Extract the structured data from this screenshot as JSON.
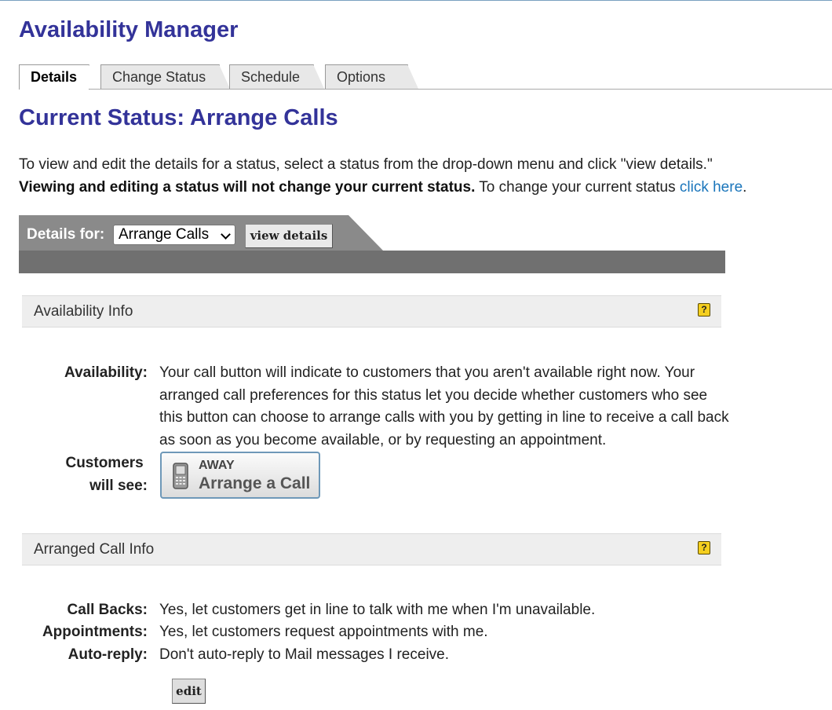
{
  "app_title": "Availability Manager",
  "tabs": [
    {
      "label": "Details",
      "active": true
    },
    {
      "label": "Change Status",
      "active": false
    },
    {
      "label": "Schedule",
      "active": false
    },
    {
      "label": "Options",
      "active": false
    }
  ],
  "status_title": "Current Status: Arrange Calls",
  "intro": {
    "line1": "To view and edit the details for a status, select a status from the drop-down menu and click \"view details.\"",
    "bold": "Viewing and editing a status will not change your current status.",
    "line2_rest": " To change your current status ",
    "link": "click here",
    "period": "."
  },
  "details_bar": {
    "label": "Details for:",
    "selected_status": "Arrange Calls",
    "view_button": "view details"
  },
  "availability_section": {
    "title": "Availability Info",
    "help": "?",
    "availability_key": "Availability:",
    "availability_value": "Your call button will indicate to customers that you aren't available right now. Your arranged call preferences for this status let you decide whether customers who see this button can choose to arrange calls with you by getting in line to receive a call back as soon as you become available, or by requesting an appointment.",
    "customers_key_line1": "Customers",
    "customers_key_line2": "will see:",
    "call_button": {
      "status": "AWAY",
      "label": "Arrange a Call",
      "icon": "phone-icon"
    }
  },
  "arranged_section": {
    "title": "Arranged Call Info",
    "help": "?",
    "rows": [
      {
        "key": "Call Backs:",
        "value": "Yes, let customers get in line to talk with me when I'm unavailable."
      },
      {
        "key": "Appointments:",
        "value": "Yes, let customers request appointments with me."
      },
      {
        "key": "Auto-reply:",
        "value": "Don't auto-reply to Mail messages I receive."
      }
    ],
    "edit_button": "edit"
  },
  "colors": {
    "title": "#333399",
    "link": "#1a75bb",
    "help_icon": "#f5cf1f",
    "bar": "#8a8a8a",
    "strip": "#707070"
  }
}
